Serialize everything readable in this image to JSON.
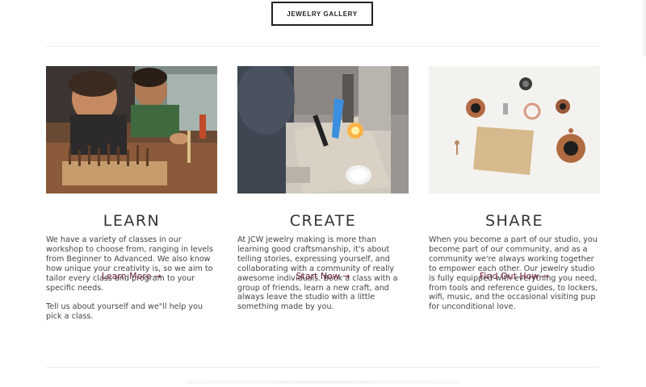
{
  "header": {
    "gallery_button": "JEWELRY GALLERY"
  },
  "columns": [
    {
      "title": "LEARN",
      "paragraphs": [
        "We have a variety of classes in our workshop to choose from, ranging in levels from Beginner to Advanced. We also know how unique your creativity is, so we aim to tailor every class and program to your specific needs.",
        "Tell us about yourself and we\"ll help you pick a class."
      ],
      "cta": "Learn More →",
      "image_alt": "two jewelers working at a bench with tools"
    },
    {
      "title": "CREATE",
      "paragraphs": [
        "At JCW jewelry making is more than learning good craftsmanship, it's about telling stories, expressing yourself, and collaborating with a community of really awesome individuals. Book a class with a group of friends, learn a new craft, and always leave the studio with a little something made by you."
      ],
      "cta": "Start Now →",
      "image_alt": "torch soldering on a workbench"
    },
    {
      "title": "SHARE",
      "paragraphs": [
        "When you become a part of our studio, you become part of our community, and as a community we're always working together to empower each other. Our jewelry studio is fully equipped with everything you need, from tools and reference guides, to lockers, wifi, music, and the occasional visiting pup for unconditional love."
      ],
      "cta": "Find Out How →",
      "image_alt": "handmade rings and pendants on white"
    }
  ],
  "colors": {
    "accent": "#6b1f33",
    "text": "#444444",
    "divider": "#ececec"
  }
}
